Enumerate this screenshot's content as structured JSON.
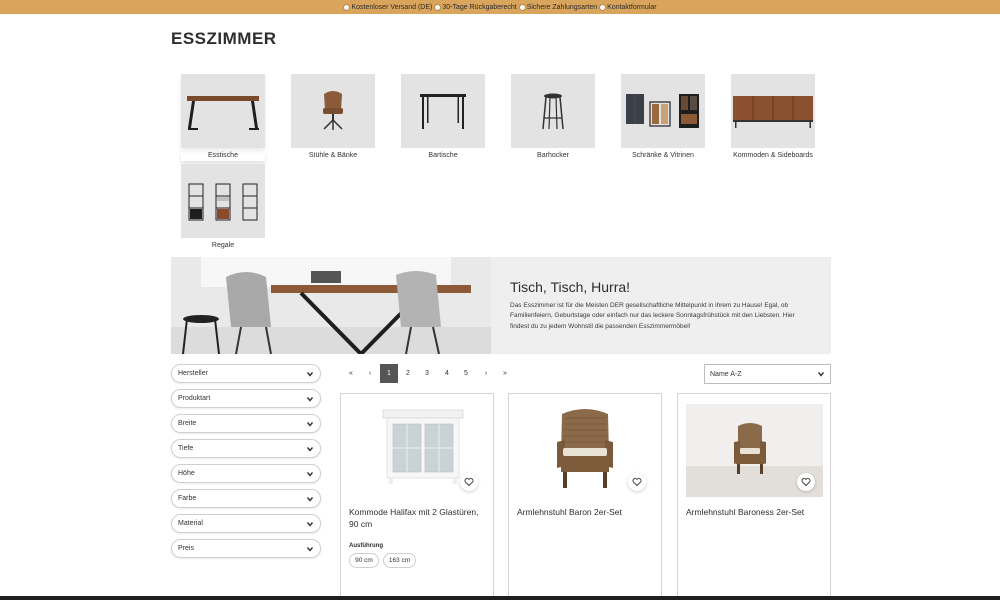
{
  "topbar": {
    "items": [
      {
        "label": "Kostenloser Versand (DE)",
        "icon": "check-circle-icon"
      },
      {
        "label": "30-Tage Rückgaberecht",
        "icon": "check-circle-icon"
      },
      {
        "label": "Sichere Zahlungsarten",
        "icon": "check-circle-icon"
      },
      {
        "label": "Kontaktformular",
        "icon": "check-circle-icon"
      }
    ],
    "background": "#d9a45c"
  },
  "page": {
    "title": "ESSZIMMER"
  },
  "categories": [
    {
      "label": "Esstische",
      "active": true
    },
    {
      "label": "Stühle & Bänke"
    },
    {
      "label": "Bartische"
    },
    {
      "label": "Barhocker"
    },
    {
      "label": "Schränke & Vitrinen"
    },
    {
      "label": "Kommoden & Sideboards"
    },
    {
      "label": "Regale"
    }
  ],
  "hero": {
    "title": "Tisch, Tisch, Hurra!",
    "text": "Das Esszimmer ist für die Meisten DER gesellschaftliche Mittelpunkt in ihrem zu Hause! Egal, ob Familienfeiern, Geburtstage oder einfach nur das leckere Sonntagsfrühstück mit den Liebsten. Hier findest du zu jedem Wohnstil die passenden Esszimmermöbel!"
  },
  "filters": [
    "Hersteller",
    "Produktart",
    "Breite",
    "Tiefe",
    "Höhe",
    "Farbe",
    "Material",
    "Preis"
  ],
  "pagination": {
    "first": "«",
    "prev": "‹",
    "pages": [
      "1",
      "2",
      "3",
      "4",
      "5"
    ],
    "current": "1",
    "next": "›",
    "last": "»"
  },
  "sort": {
    "selected": "Name A-Z"
  },
  "products": [
    {
      "name": "Kommode Halifax mit 2 Glastüren, 90 cm",
      "variant_label": "Ausführung",
      "variants": [
        "90 cm",
        "163 cm"
      ]
    },
    {
      "name": "Armlehnstuhl Baron 2er-Set"
    },
    {
      "name": "Armlehnstuhl Baroness 2er-Set"
    }
  ]
}
